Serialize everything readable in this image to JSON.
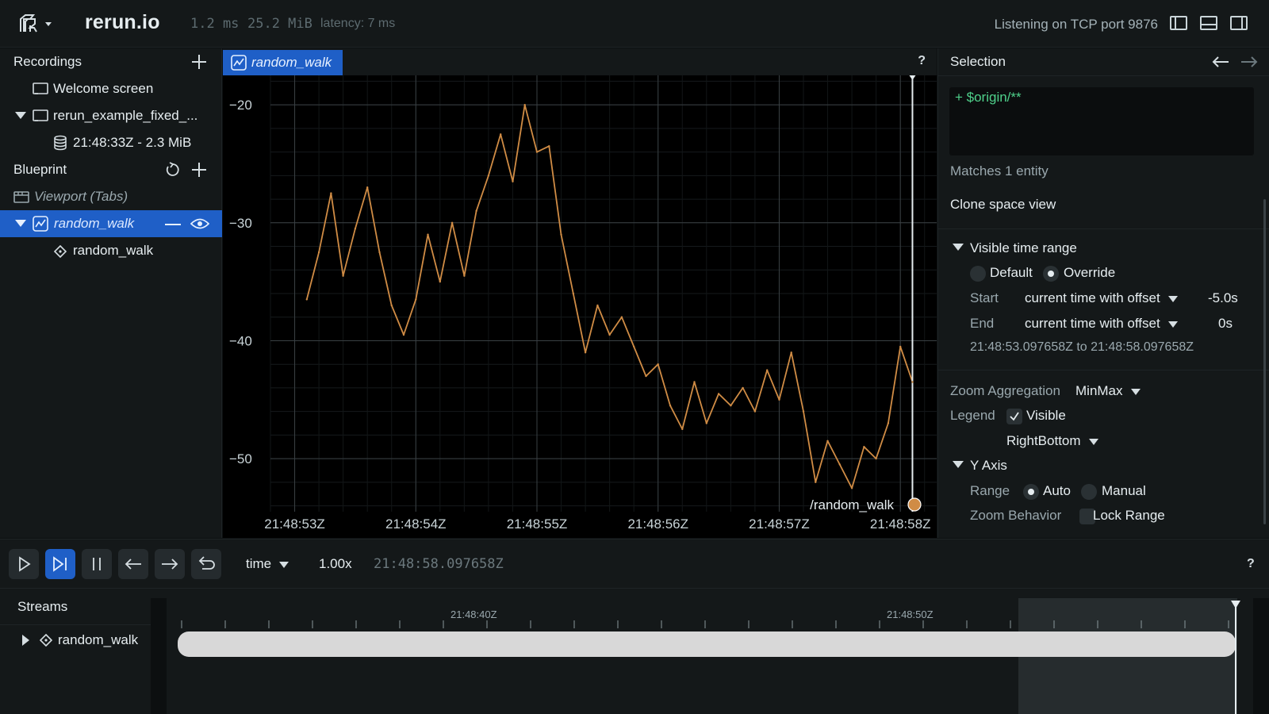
{
  "topbar": {
    "app_title": "rerun.io",
    "frame_time": "1.2 ms",
    "memory": "25.2 MiB",
    "latency": "latency: 7 ms",
    "status": "Listening on TCP port 9876"
  },
  "recordings": {
    "title": "Recordings",
    "items": [
      {
        "label": "Welcome screen"
      },
      {
        "label": "rerun_example_fixed_..."
      },
      {
        "label": "21:48:33Z - 2.3 MiB"
      }
    ]
  },
  "blueprint": {
    "title": "Blueprint",
    "viewport": "Viewport (Tabs)",
    "view": "random_walk",
    "entity": "random_walk"
  },
  "view": {
    "tab_label": "random_walk",
    "help": "?",
    "legend_label": "/random_walk",
    "series_color": "#d08c45"
  },
  "chart_data": {
    "type": "line",
    "title": "",
    "xlabel": "",
    "ylabel": "",
    "x_tick_labels": [
      "21:48:53Z",
      "21:48:54Z",
      "21:48:55Z",
      "21:48:56Z",
      "21:48:57Z",
      "21:48:58Z"
    ],
    "y_ticks": [
      -20,
      -30,
      -40,
      -50
    ],
    "y_tick_labels": [
      "−20",
      "−30",
      "−40",
      "−50"
    ],
    "xlim": [
      52.8,
      58.3
    ],
    "ylim": [
      -54.5,
      -17.5
    ],
    "grid": true,
    "legend": "bottom-right",
    "series": [
      {
        "name": "/random_walk",
        "x": [
          53.1,
          53.2,
          53.3,
          53.4,
          53.5,
          53.6,
          53.7,
          53.8,
          53.9,
          54.0,
          54.1,
          54.2,
          54.3,
          54.4,
          54.5,
          54.6,
          54.7,
          54.8,
          54.9,
          55.0,
          55.1,
          55.2,
          55.3,
          55.4,
          55.5,
          55.6,
          55.7,
          55.8,
          55.9,
          56.0,
          56.1,
          56.2,
          56.3,
          56.4,
          56.5,
          56.6,
          56.7,
          56.8,
          56.9,
          57.0,
          57.1,
          57.2,
          57.3,
          57.4,
          57.5,
          57.6,
          57.7,
          57.8,
          57.9,
          58.0,
          58.1
        ],
        "y": [
          -36.5,
          -32.5,
          -27.5,
          -34.5,
          -30.5,
          -27.0,
          -32.5,
          -37.0,
          -39.5,
          -36.5,
          -31.0,
          -35.0,
          -30.0,
          -34.5,
          -29.0,
          -26.0,
          -22.5,
          -26.5,
          -20.0,
          -24.0,
          -23.5,
          -31.0,
          -36.0,
          -41.0,
          -37.0,
          -39.5,
          -38.0,
          -40.5,
          -43.0,
          -42.0,
          -45.5,
          -47.5,
          -43.5,
          -47.0,
          -44.5,
          -45.5,
          -44.0,
          -46.0,
          -42.5,
          -45.0,
          -41.0,
          -46.0,
          -52.0,
          -48.5,
          -50.5,
          -52.5,
          -49.0,
          -50.0,
          -47.0,
          -40.5,
          -43.5
        ]
      }
    ]
  },
  "selection": {
    "title": "Selection",
    "query": "+ $origin/**",
    "matches": "Matches 1 entity",
    "clone": "Clone space view",
    "visible_time_range": "Visible time range",
    "opt_default": "Default",
    "opt_override": "Override",
    "start_label": "Start",
    "start_mode": "current time with offset",
    "start_value": "-5.0s",
    "end_label": "End",
    "end_mode": "current time with offset",
    "end_value": "0s",
    "range_text": "21:48:53.097658Z to 21:48:58.097658Z",
    "zoom_agg_label": "Zoom Aggregation",
    "zoom_agg_value": "MinMax",
    "legend_label": "Legend",
    "legend_visible": "Visible",
    "legend_position": "RightBottom",
    "y_axis": "Y Axis",
    "range_label": "Range",
    "range_auto": "Auto",
    "range_manual": "Manual",
    "zoom_behavior_label": "Zoom Behavior",
    "lock_range": "Lock Range"
  },
  "timeline": {
    "timeline_name": "time",
    "speed": "1.00x",
    "current_time": "21:48:58.097658Z",
    "help": "?",
    "streams_title": "Streams",
    "stream_entity": "random_walk",
    "tick_labels": [
      "21:48:40Z",
      "21:48:50Z"
    ]
  }
}
